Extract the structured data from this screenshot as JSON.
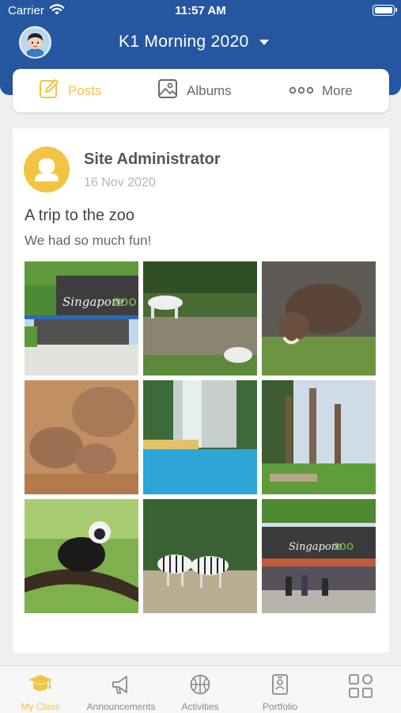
{
  "status_bar": {
    "carrier": "Carrier",
    "time": "11:57 AM"
  },
  "header": {
    "class_name": "K1 Morning 2020"
  },
  "tabs": [
    {
      "label": "Posts",
      "icon": "edit-icon",
      "active": true
    },
    {
      "label": "Albums",
      "icon": "image-icon",
      "active": false
    },
    {
      "label": "More",
      "icon": "more-dots-icon",
      "active": false
    }
  ],
  "post": {
    "author": "Site Administrator",
    "date": "16 Nov 2020",
    "title": "A trip to the zoo",
    "body": "We had so much fun!",
    "photos": [
      {
        "id": "zoo-entrance",
        "sign_text": "Singapore"
      },
      {
        "id": "white-tigers"
      },
      {
        "id": "warthog"
      },
      {
        "id": "rhinos"
      },
      {
        "id": "waterfall-pool"
      },
      {
        "id": "tree-enclosure"
      },
      {
        "id": "monkey-on-branch"
      },
      {
        "id": "zebras"
      },
      {
        "id": "zoo-gate-crowd",
        "sign_text": "Singapore"
      }
    ]
  },
  "tabbar": [
    {
      "label": "My Class",
      "icon": "graduation-cap-icon",
      "active": true
    },
    {
      "label": "Announcements",
      "icon": "megaphone-icon",
      "active": false
    },
    {
      "label": "Activities",
      "icon": "basketball-icon",
      "active": false
    },
    {
      "label": "Portfolio",
      "icon": "portfolio-icon",
      "active": false
    },
    {
      "label": "",
      "icon": "apps-grid-icon",
      "active": false
    }
  ],
  "colors": {
    "brand_blue": "#2557a0",
    "accent_yellow": "#f3c443",
    "background": "#efefef"
  }
}
